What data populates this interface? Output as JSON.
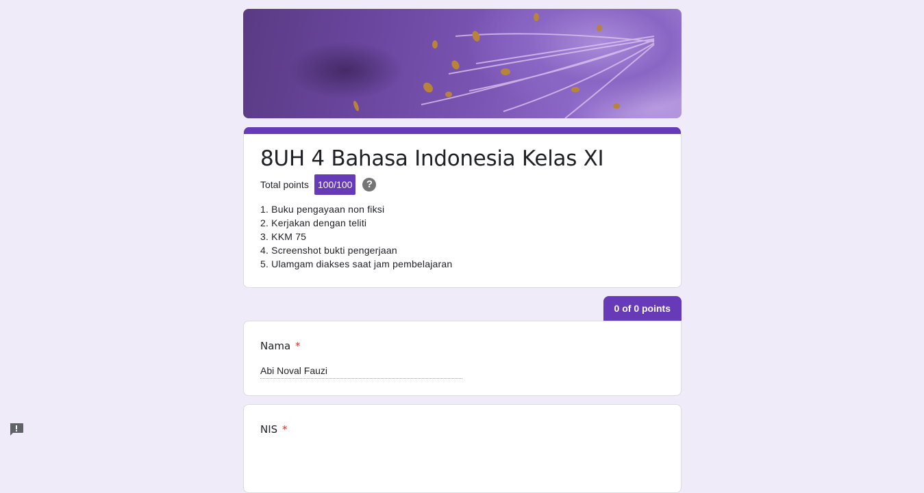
{
  "form": {
    "title": "8UH 4 Bahasa Indonesia Kelas XI",
    "total_points_label": "Total points",
    "total_points_value": "100/100",
    "description_lines": [
      "1. Buku pengayaan non fiksi",
      "2. Kerjakan dengan teliti",
      "3. KKM 75",
      "4. Screenshot bukti pengerjaan",
      "5. Ulamgam diakses saat jam pembelajaran"
    ]
  },
  "section": {
    "score_label": "0 of 0 points"
  },
  "questions": [
    {
      "label": "Nama",
      "required_mark": "*",
      "answer": "Abi Noval Fauzi"
    },
    {
      "label": "NIS",
      "required_mark": "*",
      "answer": ""
    }
  ],
  "icons": {
    "help": "help-icon",
    "report": "report-problem-icon"
  },
  "colors": {
    "accent": "#673ab7",
    "background": "#f0ebf8",
    "required": "#d93025"
  }
}
